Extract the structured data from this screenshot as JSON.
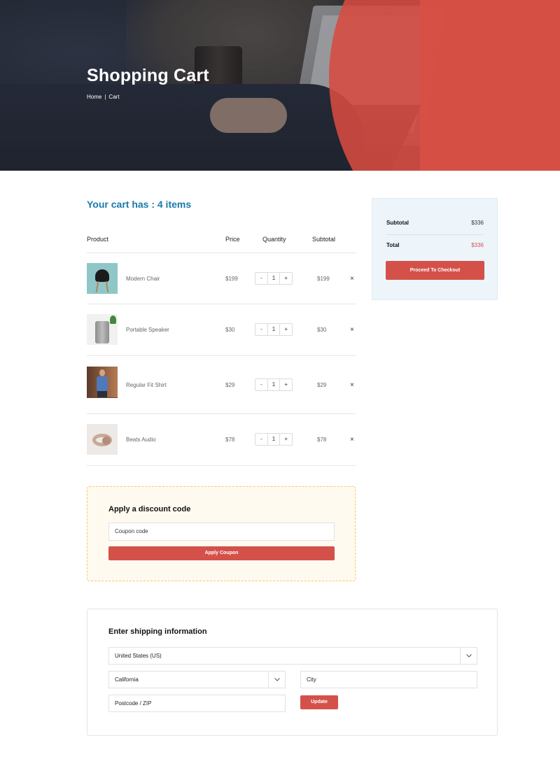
{
  "hero": {
    "title": "Shopping Cart",
    "breadcrumb": {
      "home": "Home",
      "separator": "|",
      "current": "Cart"
    }
  },
  "cart": {
    "heading": "Your cart has : 4 items",
    "columns": {
      "product": "Product",
      "price": "Price",
      "quantity": "Quantity",
      "subtotal": "Subtotal"
    },
    "qty_minus": "-",
    "qty_plus": "+",
    "remove_icon": "×",
    "items": [
      {
        "name": "Modern Chair",
        "price": "$199",
        "quantity": "1",
        "subtotal": "$199",
        "thumb": "chair"
      },
      {
        "name": "Portable Speaker",
        "price": "$30",
        "quantity": "1",
        "subtotal": "$30",
        "thumb": "speaker"
      },
      {
        "name": "Regular Fit Shirt",
        "price": "$29",
        "quantity": "1",
        "subtotal": "$29",
        "thumb": "shirt"
      },
      {
        "name": "Beats Audio",
        "price": "$78",
        "quantity": "1",
        "subtotal": "$78",
        "thumb": "audio"
      }
    ]
  },
  "summary": {
    "subtotal_label": "Subtotal",
    "subtotal_value": "$336",
    "total_label": "Total",
    "total_value": "$336",
    "checkout_label": "Proceed To Checkout"
  },
  "coupon": {
    "title": "Apply a discount code",
    "input_value": "Coupon code",
    "apply_label": "Apply Coupon"
  },
  "shipping": {
    "title": "Enter shipping information",
    "country": "United States (US)",
    "state": "California",
    "city_placeholder": "City",
    "postcode_placeholder": "Postcode / ZIP",
    "update_label": "Update"
  },
  "colors": {
    "accent": "#d4514a",
    "heading_blue": "#1a7aa8",
    "summary_bg": "#edf5fb",
    "coupon_bg": "#fffaf0",
    "coupon_border": "#f2cc62"
  }
}
